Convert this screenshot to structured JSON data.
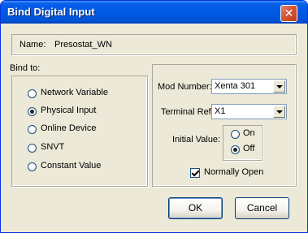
{
  "window": {
    "title": "Bind Digital Input"
  },
  "name_row": {
    "label": "Name:",
    "value": "Presostat_WN"
  },
  "bind_to": {
    "label": "Bind to:",
    "options": [
      {
        "label": "Network Variable",
        "checked": false
      },
      {
        "label": "Physical Input",
        "checked": true
      },
      {
        "label": "Online Device",
        "checked": false
      },
      {
        "label": "SNVT",
        "checked": false
      },
      {
        "label": "Constant Value",
        "checked": false
      }
    ]
  },
  "details": {
    "mod_number": {
      "label": "Mod Number:",
      "value": "Xenta 301"
    },
    "terminal_ref": {
      "label": "Terminal Ref:",
      "value": "X1"
    },
    "initial_value": {
      "label": "Initial Value:",
      "on_label": "On",
      "off_label": "Off",
      "selected": "Off"
    },
    "normally_open": {
      "label": "Normally Open",
      "checked": true
    }
  },
  "buttons": {
    "ok": "OK",
    "cancel": "Cancel"
  }
}
